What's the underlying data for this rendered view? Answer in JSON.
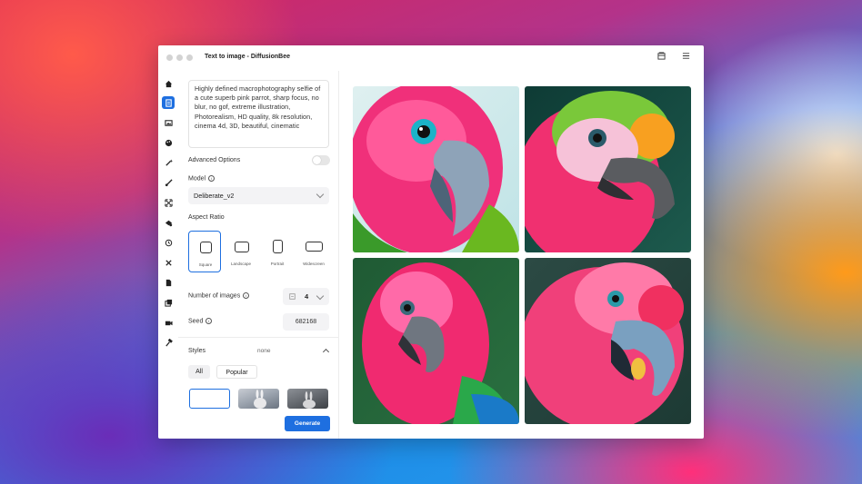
{
  "window": {
    "title": "Text to image - DiffusionBee"
  },
  "sidebar_icons": [
    "home-icon",
    "text-to-image-icon",
    "image-to-image-icon",
    "palette-icon",
    "magic-wand-icon",
    "brush-icon",
    "expand-icon",
    "layers-icon",
    "history-icon",
    "tools-icon",
    "document-icon",
    "gallery-icon",
    "video-icon",
    "hammer-icon"
  ],
  "prompt": {
    "text": "Highly defined macrophotography selfie of a cute superb pink parrot, sharp focus, no blur, no gof, extreme illustration, Photorealism, HD quality, 8k resolution, cinema 4d, 3D, beautiful, cinematic"
  },
  "advanced": {
    "label": "Advanced Options",
    "enabled": false
  },
  "model": {
    "label": "Model",
    "value": "Deliberate_v2"
  },
  "aspect": {
    "label": "Aspect Ratio",
    "options": [
      "Square",
      "Landscape",
      "Portrait",
      "Widescreen"
    ],
    "selected": "Square"
  },
  "num_images": {
    "label": "Number of images",
    "value": "4"
  },
  "seed": {
    "label": "Seed",
    "value": "682168"
  },
  "styles": {
    "label": "Styles",
    "value": "none",
    "tabs": [
      "All",
      "Popular"
    ]
  },
  "generate_label": "Generate",
  "colors": {
    "accent": "#1e6fe0"
  }
}
